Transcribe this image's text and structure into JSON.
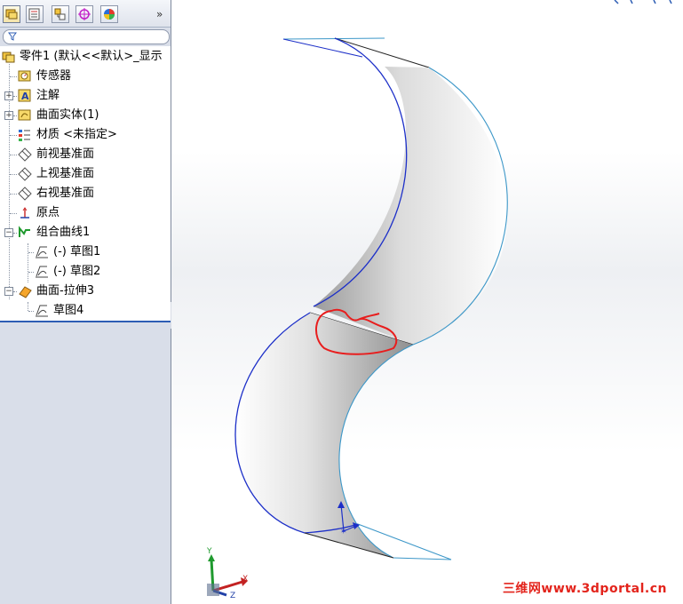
{
  "panel_tabs": [
    {
      "name": "feature-manager",
      "icon": "feature-tree-icon"
    },
    {
      "name": "property-manager",
      "icon": "property-icon"
    },
    {
      "name": "configuration-manager",
      "icon": "configuration-icon"
    },
    {
      "name": "dimxpert-manager",
      "icon": "crosshair-icon"
    },
    {
      "name": "display-manager",
      "icon": "color-wheel-icon"
    }
  ],
  "more_tabs_glyph": "»",
  "tree": {
    "root": "零件1  (默认<<默认>_显示",
    "items": [
      {
        "label": "传感器",
        "icon": "sensor-icon"
      },
      {
        "label": "注解",
        "icon": "annotation-icon"
      },
      {
        "label": "曲面实体(1)",
        "icon": "surface-body-folder-icon"
      },
      {
        "label": "材质 <未指定>",
        "icon": "material-icon"
      },
      {
        "label": "前视基准面",
        "icon": "plane-icon"
      },
      {
        "label": "上视基准面",
        "icon": "plane-icon"
      },
      {
        "label": "右视基准面",
        "icon": "plane-icon"
      },
      {
        "label": "原点",
        "icon": "origin-icon"
      },
      {
        "label": "组合曲线1",
        "icon": "composite-curve-icon"
      },
      {
        "label": "(-) 草图1",
        "icon": "sketch-icon"
      },
      {
        "label": "(-) 草图2",
        "icon": "sketch-icon"
      },
      {
        "label": "曲面-拉伸3",
        "icon": "extrude-surface-icon"
      },
      {
        "label": "草图4",
        "icon": "sketch-icon"
      }
    ]
  },
  "triad": {
    "x": "X",
    "y": "Y",
    "z": "Z"
  },
  "watermark": "三维网www.3dportal.cn",
  "colors": {
    "accent": "#2d5db4",
    "edge_dark": "#1c2fc8",
    "edge_light": "#3c97c8",
    "markup": "#e81d1d"
  }
}
